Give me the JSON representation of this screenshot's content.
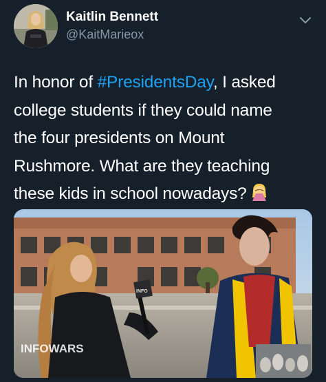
{
  "colors": {
    "background": "#15202b",
    "text_primary": "#ffffff",
    "text_secondary": "#8899a6",
    "link": "#1da1f2"
  },
  "tweet": {
    "author": {
      "name": "Kaitlin Bennett",
      "handle": "@KaitMarieox",
      "avatar": "profile-photo"
    },
    "menu_icon": "chevron-down-icon",
    "text": {
      "line1_pre": "In honor of ",
      "hashtag": "#PresidentsDay",
      "line1_post": ", I asked",
      "line2": "college students if they could name",
      "line3": "the four presidents on Mount",
      "line4": "Rushmore. What are they teaching",
      "line5": "these kids in school nowadays?",
      "emoji": "face-palm-emoji"
    },
    "media": {
      "type": "video-still",
      "watermark": "INFOWARS",
      "mic_flag": "INFO WARS",
      "inset": "mount-rushmore-thumbnail"
    }
  }
}
